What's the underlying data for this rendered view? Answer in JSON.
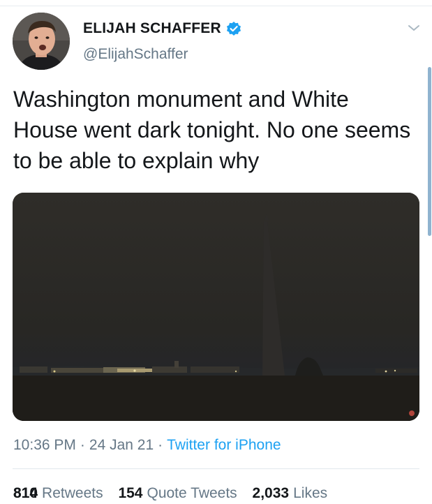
{
  "user": {
    "display_name": "ELIJAH SCHAFFER",
    "handle": "@ElijahSchaffer",
    "verified": true,
    "avatar_icon": "profile-photo"
  },
  "tweet": {
    "text": "Washington monument and White House went dark tonight. No one seems to be able to explain why",
    "time": "10:36 PM",
    "date": "24 Jan 21",
    "separator": "·",
    "source": "Twitter for iPhone"
  },
  "stats": {
    "retweets": {
      "count": "814",
      "count_overlap": "810",
      "label": "Retweets"
    },
    "quotes": {
      "count": "154",
      "label": "Quote Tweets"
    },
    "likes": {
      "count": "2,033",
      "label": "Likes"
    }
  },
  "colors": {
    "accent": "#1da1f2",
    "text": "#14171a",
    "muted": "#657786",
    "night_sky": "#2b2a27"
  },
  "icons": {
    "verified": "verified-badge-icon",
    "caret": "chevron-down-icon"
  }
}
